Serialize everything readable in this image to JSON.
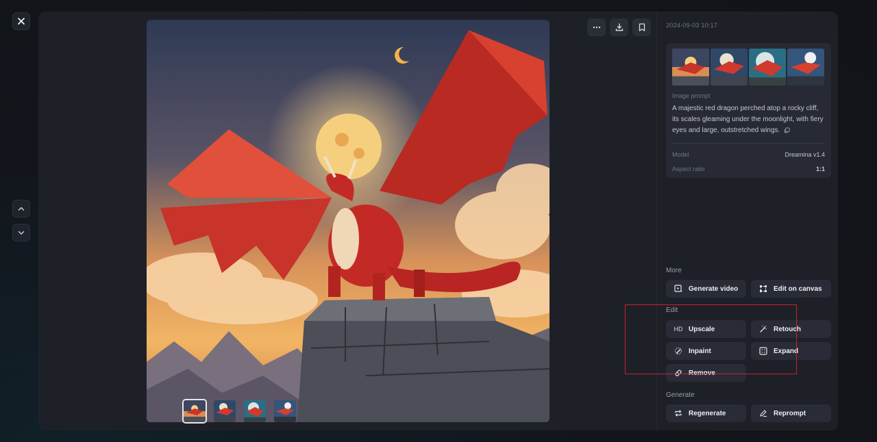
{
  "nav": {
    "close_icon": "close-icon",
    "prev_icon": "chevron-up-icon",
    "next_icon": "chevron-down-icon"
  },
  "viewer": {
    "image_alt": "A majestic red dragon perched atop a rocky cliff under a full moon",
    "top_actions": [
      {
        "name": "more-options",
        "icon": "ellipsis-icon"
      },
      {
        "name": "download",
        "icon": "download-icon"
      },
      {
        "name": "bookmark",
        "icon": "bookmark-icon"
      }
    ],
    "thumbnails": [
      {
        "label": "Variation 1",
        "selected": true
      },
      {
        "label": "Variation 2",
        "selected": false
      },
      {
        "label": "Variation 3",
        "selected": false
      },
      {
        "label": "Variation 4",
        "selected": false
      }
    ]
  },
  "details": {
    "timestamp": "2024-09-03 10:17",
    "prompt_label": "Image prompt",
    "prompt_text": "A majestic red dragon perched atop a rocky cliff, its scales gleaming under the moonlight, with fiery eyes and large, outstretched wings.",
    "model_label": "Model",
    "model_value": "Dreamina v1.4",
    "aspect_label": "Aspect ratio",
    "aspect_value": "1:1"
  },
  "sections": {
    "more": {
      "title": "More",
      "buttons": [
        {
          "label": "Generate video",
          "icon": "video-icon"
        },
        {
          "label": "Edit on canvas",
          "icon": "canvas-icon"
        }
      ]
    },
    "edit": {
      "title": "Edit",
      "buttons": [
        {
          "label": "Upscale",
          "icon": "hd-icon",
          "icon_text": "HD"
        },
        {
          "label": "Retouch",
          "icon": "magic-wand-icon"
        },
        {
          "label": "Inpaint",
          "icon": "inpaint-brush-icon"
        },
        {
          "label": "Expand",
          "icon": "expand-icon"
        },
        {
          "label": "Remove",
          "icon": "eraser-icon"
        }
      ]
    },
    "generate": {
      "title": "Generate",
      "buttons": [
        {
          "label": "Regenerate",
          "icon": "regenerate-icon"
        },
        {
          "label": "Reprompt",
          "icon": "pencil-icon"
        }
      ]
    }
  },
  "colors": {
    "highlight": "#d0202a",
    "panel_bg": "#1e2028",
    "button_bg": "#292c36"
  }
}
